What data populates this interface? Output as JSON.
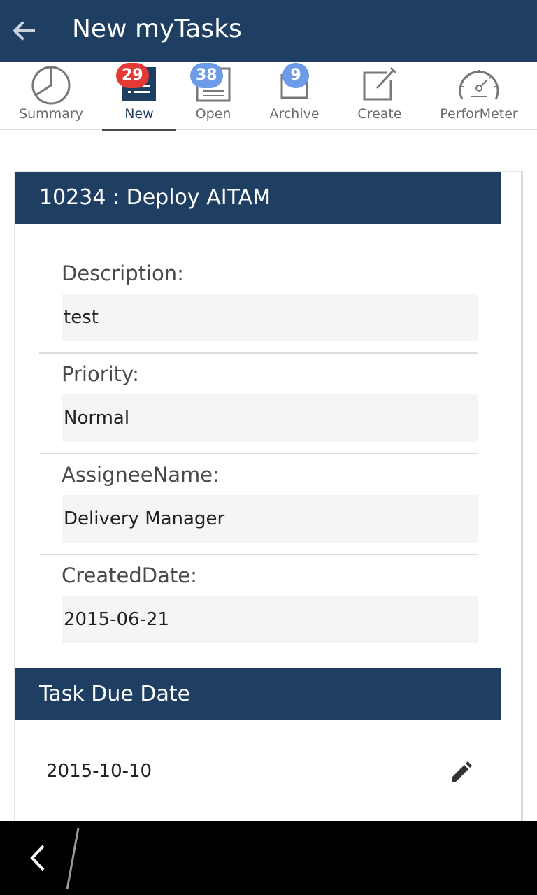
{
  "appbar": {
    "title": "New myTasks",
    "back_icon": "arrow-left-icon"
  },
  "tabs": [
    {
      "label": "Summary",
      "icon": "pie-chart-icon",
      "badge": null
    },
    {
      "label": "New",
      "icon": "new-list-icon",
      "badge": "29",
      "badge_color": "#e53935",
      "active": true
    },
    {
      "label": "Open",
      "icon": "open-list-icon",
      "badge": "38",
      "badge_color": "#6c9be8"
    },
    {
      "label": "Archive",
      "icon": "archive-icon",
      "badge": "9",
      "badge_color": "#6c9be8"
    },
    {
      "label": "Create",
      "icon": "edit-square-icon",
      "badge": null
    },
    {
      "label": "PerforMeter",
      "icon": "speedometer-icon",
      "badge": null
    }
  ],
  "task": {
    "header": "10234 : Deploy AITAM",
    "fields": [
      {
        "label": "Description:",
        "value": "test"
      },
      {
        "label": "Priority:",
        "value": "Normal"
      },
      {
        "label": "AssigneeName:",
        "value": "Delivery Manager"
      },
      {
        "label": "CreatedDate:",
        "value": "2015-06-21"
      }
    ]
  },
  "due": {
    "header": "Task Due Date",
    "value": "2015-10-10",
    "edit_icon": "pencil-icon"
  },
  "colors": {
    "primary": "#1f3f62",
    "badge_red": "#e53935",
    "badge_blue": "#6c9be8"
  }
}
